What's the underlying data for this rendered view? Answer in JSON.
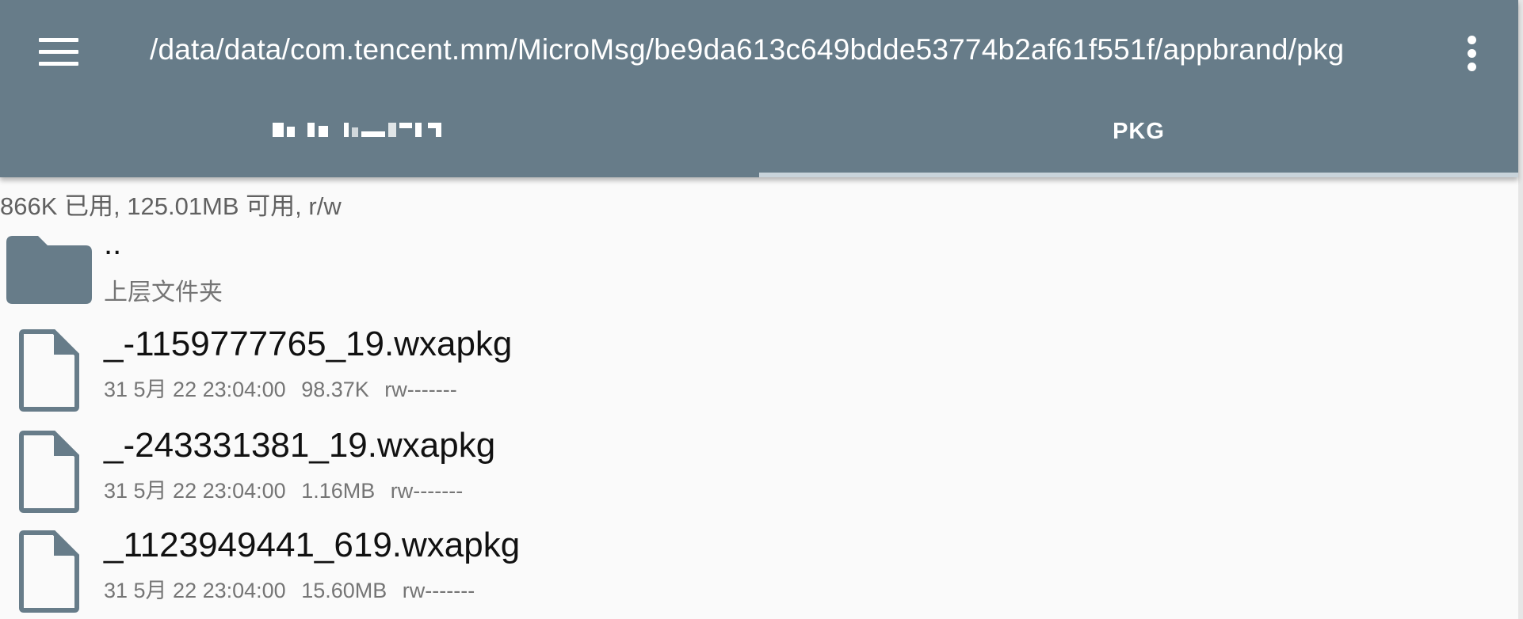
{
  "appbar": {
    "menu_icon": "hamburger-menu-icon",
    "path": "/data/data/com.tencent.mm/MicroMsg/be9da613c649bdde53774b2af61f551f/appbrand/pkg",
    "overflow_icon": "more-vert-icon"
  },
  "tabs": [
    {
      "label": "",
      "pixelated": true
    },
    {
      "label": "PKG",
      "selected": true
    }
  ],
  "storage_info": "866K 已用, 125.01MB 可用, r/w",
  "parent": {
    "name": "..",
    "subtitle": "上层文件夹",
    "icon": "folder-icon"
  },
  "files": [
    {
      "name": "_-1159777765_19.wxapkg",
      "date": "31 5月 22 23:04:00",
      "size": "98.37K",
      "perms": "rw-------",
      "icon": "file-icon"
    },
    {
      "name": "_-243331381_19.wxapkg",
      "date": "31 5月 22 23:04:00",
      "size": "1.16MB",
      "perms": "rw-------",
      "icon": "file-icon"
    },
    {
      "name": "_1123949441_619.wxapkg",
      "date": "31 5月 22 23:04:00",
      "size": "15.60MB",
      "perms": "rw-------",
      "icon": "file-icon"
    }
  ],
  "colors": {
    "appbar": "#677c89",
    "icon": "#677c89",
    "background": "#fafafa",
    "tab_indicator": "#c8d3da"
  }
}
